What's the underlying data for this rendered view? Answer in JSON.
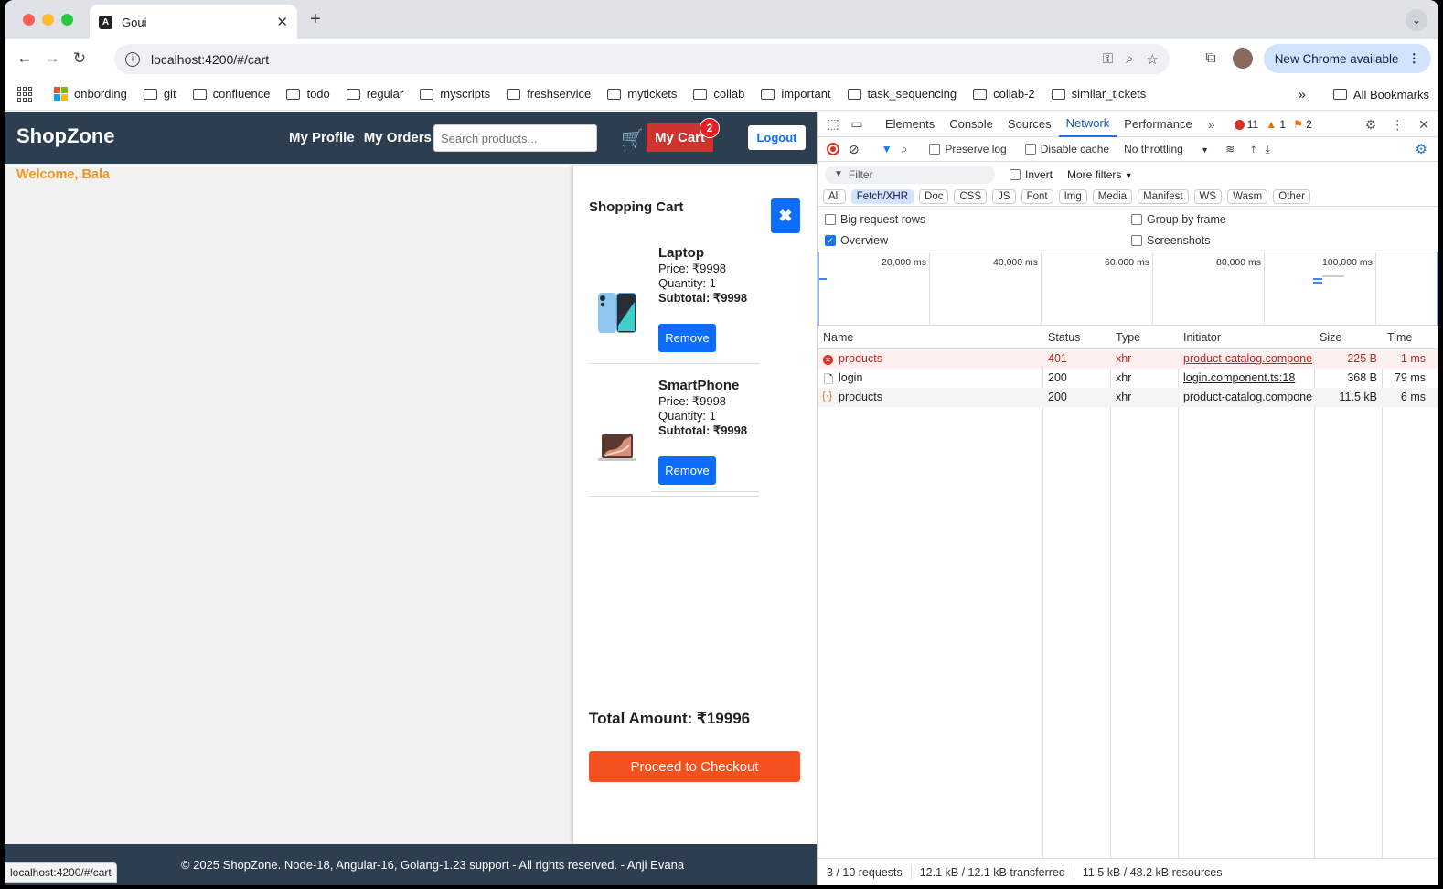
{
  "browser": {
    "tab_title": "Goui",
    "url": "localhost:4200/#/cart",
    "update_label": "New Chrome available",
    "status_url": "localhost:4200/#/cart",
    "colors": {
      "close": "#ff5f57",
      "minimize": "#febc2e",
      "maximize": "#28c840"
    }
  },
  "bookmarks": {
    "items": [
      "onbording",
      "git",
      "confluence",
      "todo",
      "regular",
      "myscripts",
      "freshservice",
      "mytickets",
      "collab",
      "important",
      "task_sequencing",
      "collab-2",
      "similar_tickets"
    ],
    "overflow": "»",
    "all": "All Bookmarks"
  },
  "app": {
    "brand": "ShopZone",
    "nav": {
      "profile": "My Profile",
      "orders": "My Orders"
    },
    "search_placeholder": "Search products...",
    "cart_label": "My Cart",
    "cart_count": "2",
    "logout": "Logout",
    "welcome": "Welcome, Bala",
    "cart": {
      "title": "Shopping Cart",
      "close_icon": "✖",
      "items": [
        {
          "name": "Laptop",
          "price": "Price: ₹9998",
          "quantity": "Quantity: 1",
          "subtotal": "Subtotal: ₹9998",
          "remove": "Remove"
        },
        {
          "name": "SmartPhone",
          "price": "Price: ₹9998",
          "quantity": "Quantity: 1",
          "subtotal": "Subtotal: ₹9998",
          "remove": "Remove"
        }
      ],
      "total": "Total Amount: ₹19996",
      "checkout": "Proceed to Checkout"
    },
    "footer": "© 2025 ShopZone. Node-18, Angular-16, Golang-1.23 support - All rights reserved. - Anji Evana",
    "colors": {
      "nav": "#2c3e50",
      "accent": "#f0961e",
      "primary": "#0d6efd",
      "cart": "#d0322d",
      "checkout": "#f4511e"
    }
  },
  "devtools": {
    "tabs": [
      "Elements",
      "Console",
      "Sources",
      "Network",
      "Performance"
    ],
    "active_tab": "Network",
    "errors": "11",
    "warnings": "1",
    "issues": "2",
    "preserve_log": "Preserve log",
    "disable_cache": "Disable cache",
    "throttling": "No throttling",
    "filter_placeholder": "Filter",
    "invert": "Invert",
    "more_filters": "More filters",
    "types": [
      "All",
      "Fetch/XHR",
      "Doc",
      "CSS",
      "JS",
      "Font",
      "Img",
      "Media",
      "Manifest",
      "WS",
      "Wasm",
      "Other"
    ],
    "active_type": "Fetch/XHR",
    "big_rows": "Big request rows",
    "group_by_frame": "Group by frame",
    "overview": "Overview",
    "screenshots": "Screenshots",
    "timeline_ticks": [
      "20,000 ms",
      "40,000 ms",
      "60,000 ms",
      "80,000 ms",
      "100,000 ms"
    ],
    "columns": [
      "Name",
      "Status",
      "Type",
      "Initiator",
      "Size",
      "Time"
    ],
    "rows": [
      {
        "name": "products",
        "status": "401",
        "type": "xhr",
        "initiator": "product-catalog.compone",
        "size": "225 B",
        "time": "1 ms",
        "icon": "error-icon"
      },
      {
        "name": "login",
        "status": "200",
        "type": "xhr",
        "initiator": "login.component.ts:18",
        "size": "368 B",
        "time": "79 ms",
        "icon": "document-icon"
      },
      {
        "name": "products",
        "status": "200",
        "type": "xhr",
        "initiator": "product-catalog.compone",
        "size": "11.5 kB",
        "time": "6 ms",
        "icon": "fetch-icon"
      }
    ],
    "summary": {
      "requests": "3 / 10 requests",
      "transferred": "12.1 kB / 12.1 kB transferred",
      "resources": "11.5 kB / 48.2 kB resources"
    }
  }
}
